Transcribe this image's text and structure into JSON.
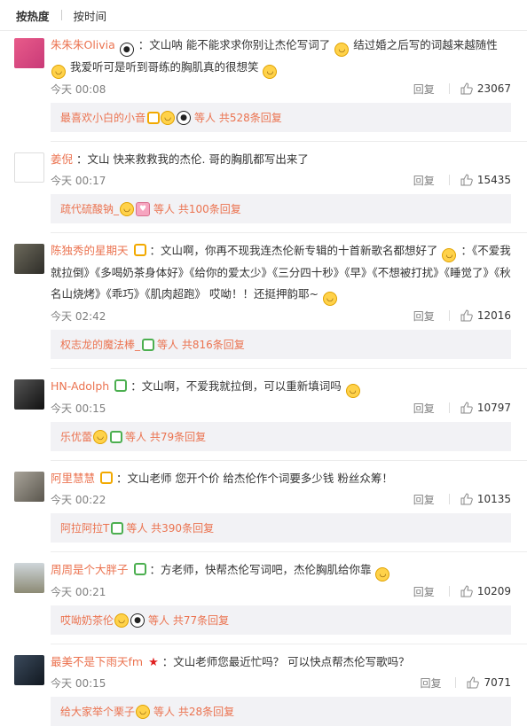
{
  "tabs": [
    "按热度",
    "按时间"
  ],
  "comments": [
    {
      "user": "朱朱朱Olivia",
      "text": "：文山呐 能不能求求你别让杰伦写词了",
      "text2": "结过婚之后写的词越来越随性",
      "text3": "我爱听可是听到哥练的胸肌真的很想笑",
      "time": "今天 00:08",
      "reply": "回复",
      "likes": "23067",
      "replies_users": "最喜欢小白的小音",
      "replies_suffix": "等人 共528条回复"
    },
    {
      "user": "姜倪",
      "text": "：文山  快来救救我的杰伦. 哥的胸肌都写出来了",
      "time": "今天 00:17",
      "reply": "回复",
      "likes": "15435",
      "replies_users": "疏代硫酸钠_",
      "replies_suffix": "等人 共100条回复"
    },
    {
      "user": "陈独秀的星期天",
      "text": "：文山啊，你再不现我连杰伦新专辑的十首新歌名都想好了",
      "text2": "：《不爱我就拉倒》《多喝奶茶身体好》《给你的爱太少》《三分四十秒》《早》《不想被打扰》《睡觉了》《秋名山烧烤》《乖巧》《肌肉超跑》 哎呦！！还挺押韵耶~",
      "time": "今天 02:42",
      "reply": "回复",
      "likes": "12016",
      "replies_users": "权志龙的魔法棒_",
      "replies_suffix": "等人 共816条回复"
    },
    {
      "user": "HN-Adolph",
      "text": "：文山啊，不爱我就拉倒，可以重新填词吗",
      "time": "今天 00:15",
      "reply": "回复",
      "likes": "10797",
      "replies_users": "乐优蕾",
      "replies_suffix": "等人 共79条回复"
    },
    {
      "user": "阿里慧慧",
      "text": "：文山老师 您开个价 给杰伦作个词要多少钱 粉丝众筹！",
      "time": "今天 00:22",
      "reply": "回复",
      "likes": "10135",
      "replies_users": "阿拉阿拉T",
      "replies_suffix": "等人 共390条回复"
    },
    {
      "user": "周周是个大胖子",
      "text": "：方老师，快帮杰伦写词吧，杰伦胸肌给你靠",
      "time": "今天 00:21",
      "reply": "回复",
      "likes": "10209",
      "replies_users": "哎呦奶茶伦",
      "replies_suffix": "等人 共77条回复"
    },
    {
      "user": "最美不是下雨天fm",
      "text": "：文山老师您最近忙吗？ 可以快点帮杰伦写歌吗？",
      "time": "今天 00:15",
      "reply": "回复",
      "likes": "7071",
      "replies_users": "给大家举个栗子",
      "replies_suffix": "等人 共28条回复"
    }
  ],
  "colors": {
    "username": "#eb7350",
    "reply_bg": "#f2f2f5",
    "meta": "#808080"
  }
}
